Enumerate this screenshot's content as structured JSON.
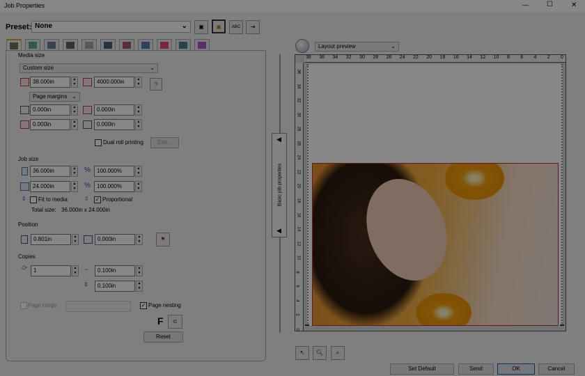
{
  "window": {
    "title": "Job Properties",
    "min": "—",
    "max": "☐",
    "close": "✕"
  },
  "preset": {
    "label": "Preset:",
    "value": "None",
    "buttons": [
      "save-icon",
      "save-as-icon",
      "abc-icon",
      "import-icon"
    ],
    "abc": "ABC"
  },
  "tabs": [
    "media-icon",
    "layout-icon",
    "page-icon",
    "printer-icon",
    "grid-icon",
    "crop-icon",
    "color-bars-icon",
    "stack-icon",
    "ink-icon",
    "house-icon",
    "color-profile-icon"
  ],
  "media": {
    "title": "Media size",
    "size": "Custom size",
    "width": "38.000in",
    "height": "4000.000in",
    "margins_select": "Page margins",
    "m1": "0.000in",
    "m2": "0.000in",
    "m3": "0.000in",
    "m4": "0.000in",
    "dual_roll": "Dual roll printing",
    "edit": "Edit..."
  },
  "job": {
    "title": "Job size",
    "width": "36.000in",
    "height": "24.000in",
    "pct1": "100.000%",
    "pct2": "100.000%",
    "pct_sym": "%",
    "fit": "Fit to media",
    "proportional": "Proportional",
    "total_label": "Total size:",
    "total_value": "36.000in x 24.000in"
  },
  "position": {
    "title": "Position",
    "x": "0.801in",
    "y": "0.000in"
  },
  "copies": {
    "title": "Copies",
    "count": "1",
    "h_gap": "0.100in",
    "v_gap": "0.100in"
  },
  "page_range": {
    "label": "Page range:",
    "value": ""
  },
  "page_nesting": {
    "label": "Page nesting",
    "checked": true
  },
  "font_button": "F",
  "reset": "Reset",
  "splitter": {
    "label": "Basic job properties",
    "arrow": "◀"
  },
  "preview": {
    "mode": "Layout preview",
    "top_ruler": [
      "38",
      "36",
      "34",
      "32",
      "30",
      "28",
      "26",
      "24",
      "22",
      "20",
      "18",
      "16",
      "14",
      "12",
      "10",
      "8",
      "6",
      "4",
      "2",
      "0"
    ],
    "left_ruler": [
      "36",
      "34",
      "32",
      "30",
      "28",
      "26",
      "24",
      "22",
      "20",
      "18",
      "16",
      "14",
      "12",
      "10",
      "8",
      "6",
      "4",
      "2",
      "0"
    ],
    "image_accent": "#f0a030"
  },
  "tools": [
    "pointer-icon",
    "zoom-icon",
    "zoom-out-icon"
  ],
  "footer": {
    "set_default": "Set Default",
    "send": "Send",
    "ok": "OK",
    "cancel": "Cancel"
  }
}
